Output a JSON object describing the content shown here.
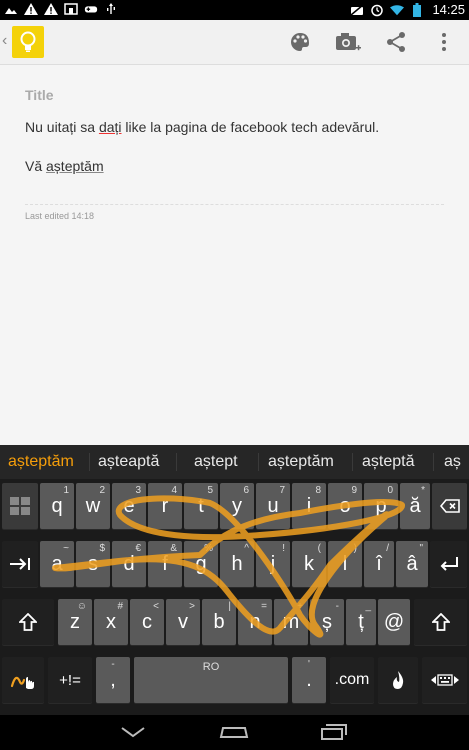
{
  "status": {
    "time": "14:25"
  },
  "note": {
    "title_placeholder": "Title",
    "line1_before": "Nu uitați sa ",
    "line1_word": "dați",
    "line1_after": " like la pagina de facebook tech adevărul.",
    "line2_before": "Vă ",
    "line2_word": "așteptăm",
    "last_edited": "Last edited 14:18"
  },
  "keyboard": {
    "suggestions": [
      {
        "text": "așteptăm",
        "selected": true
      },
      {
        "text": "așteaptă",
        "selected": false
      },
      {
        "text": "aștept",
        "selected": false
      },
      {
        "text": "așteptăm",
        "selected": false
      },
      {
        "text": "așteptă",
        "selected": false
      },
      {
        "text": "aș",
        "selected": false
      }
    ],
    "row1": [
      {
        "label": "q",
        "hint": "1"
      },
      {
        "label": "w",
        "hint": "2"
      },
      {
        "label": "e",
        "hint": "3"
      },
      {
        "label": "r",
        "hint": "4"
      },
      {
        "label": "t",
        "hint": "5"
      },
      {
        "label": "y",
        "hint": "6"
      },
      {
        "label": "u",
        "hint": "7"
      },
      {
        "label": "i",
        "hint": "8"
      },
      {
        "label": "o",
        "hint": "9"
      },
      {
        "label": "p",
        "hint": "0"
      },
      {
        "label": "ă",
        "hint": "*"
      }
    ],
    "row2": [
      {
        "label": "a",
        "hint": "~"
      },
      {
        "label": "s",
        "hint": "$"
      },
      {
        "label": "d",
        "hint": "€"
      },
      {
        "label": "f",
        "hint": "&"
      },
      {
        "label": "g",
        "hint": "%"
      },
      {
        "label": "h",
        "hint": "^"
      },
      {
        "label": "j",
        "hint": "!"
      },
      {
        "label": "k",
        "hint": "("
      },
      {
        "label": "l",
        "hint": ")"
      },
      {
        "label": "î",
        "hint": "/"
      },
      {
        "label": "â",
        "hint": "\""
      }
    ],
    "row3": [
      {
        "label": "z",
        "hint": "☺"
      },
      {
        "label": "x",
        "hint": "#"
      },
      {
        "label": "c",
        "hint": "<"
      },
      {
        "label": "v",
        "hint": ">"
      },
      {
        "label": "b",
        "hint": "|"
      },
      {
        "label": "n",
        "hint": "="
      },
      {
        "label": "m",
        "hint": "+"
      },
      {
        "label": "ș",
        "hint": "-"
      },
      {
        "label": "ț",
        "hint": "_"
      },
      {
        "label": "@",
        "hint": ""
      }
    ],
    "sym_key": "+!=",
    "comma_key": ",",
    "comma_hint": "-",
    "space_label": "RO",
    "period_key": ".",
    "period_hint": "'",
    "dotcom_key": ".com",
    "keypad_top_left": "1 2",
    "keypad_bottom_left": "3 4"
  },
  "colors": {
    "swipe_trail": "#f0a020",
    "suggestion_selected": "#f59e0b",
    "app_logo": "#f4d20a"
  }
}
